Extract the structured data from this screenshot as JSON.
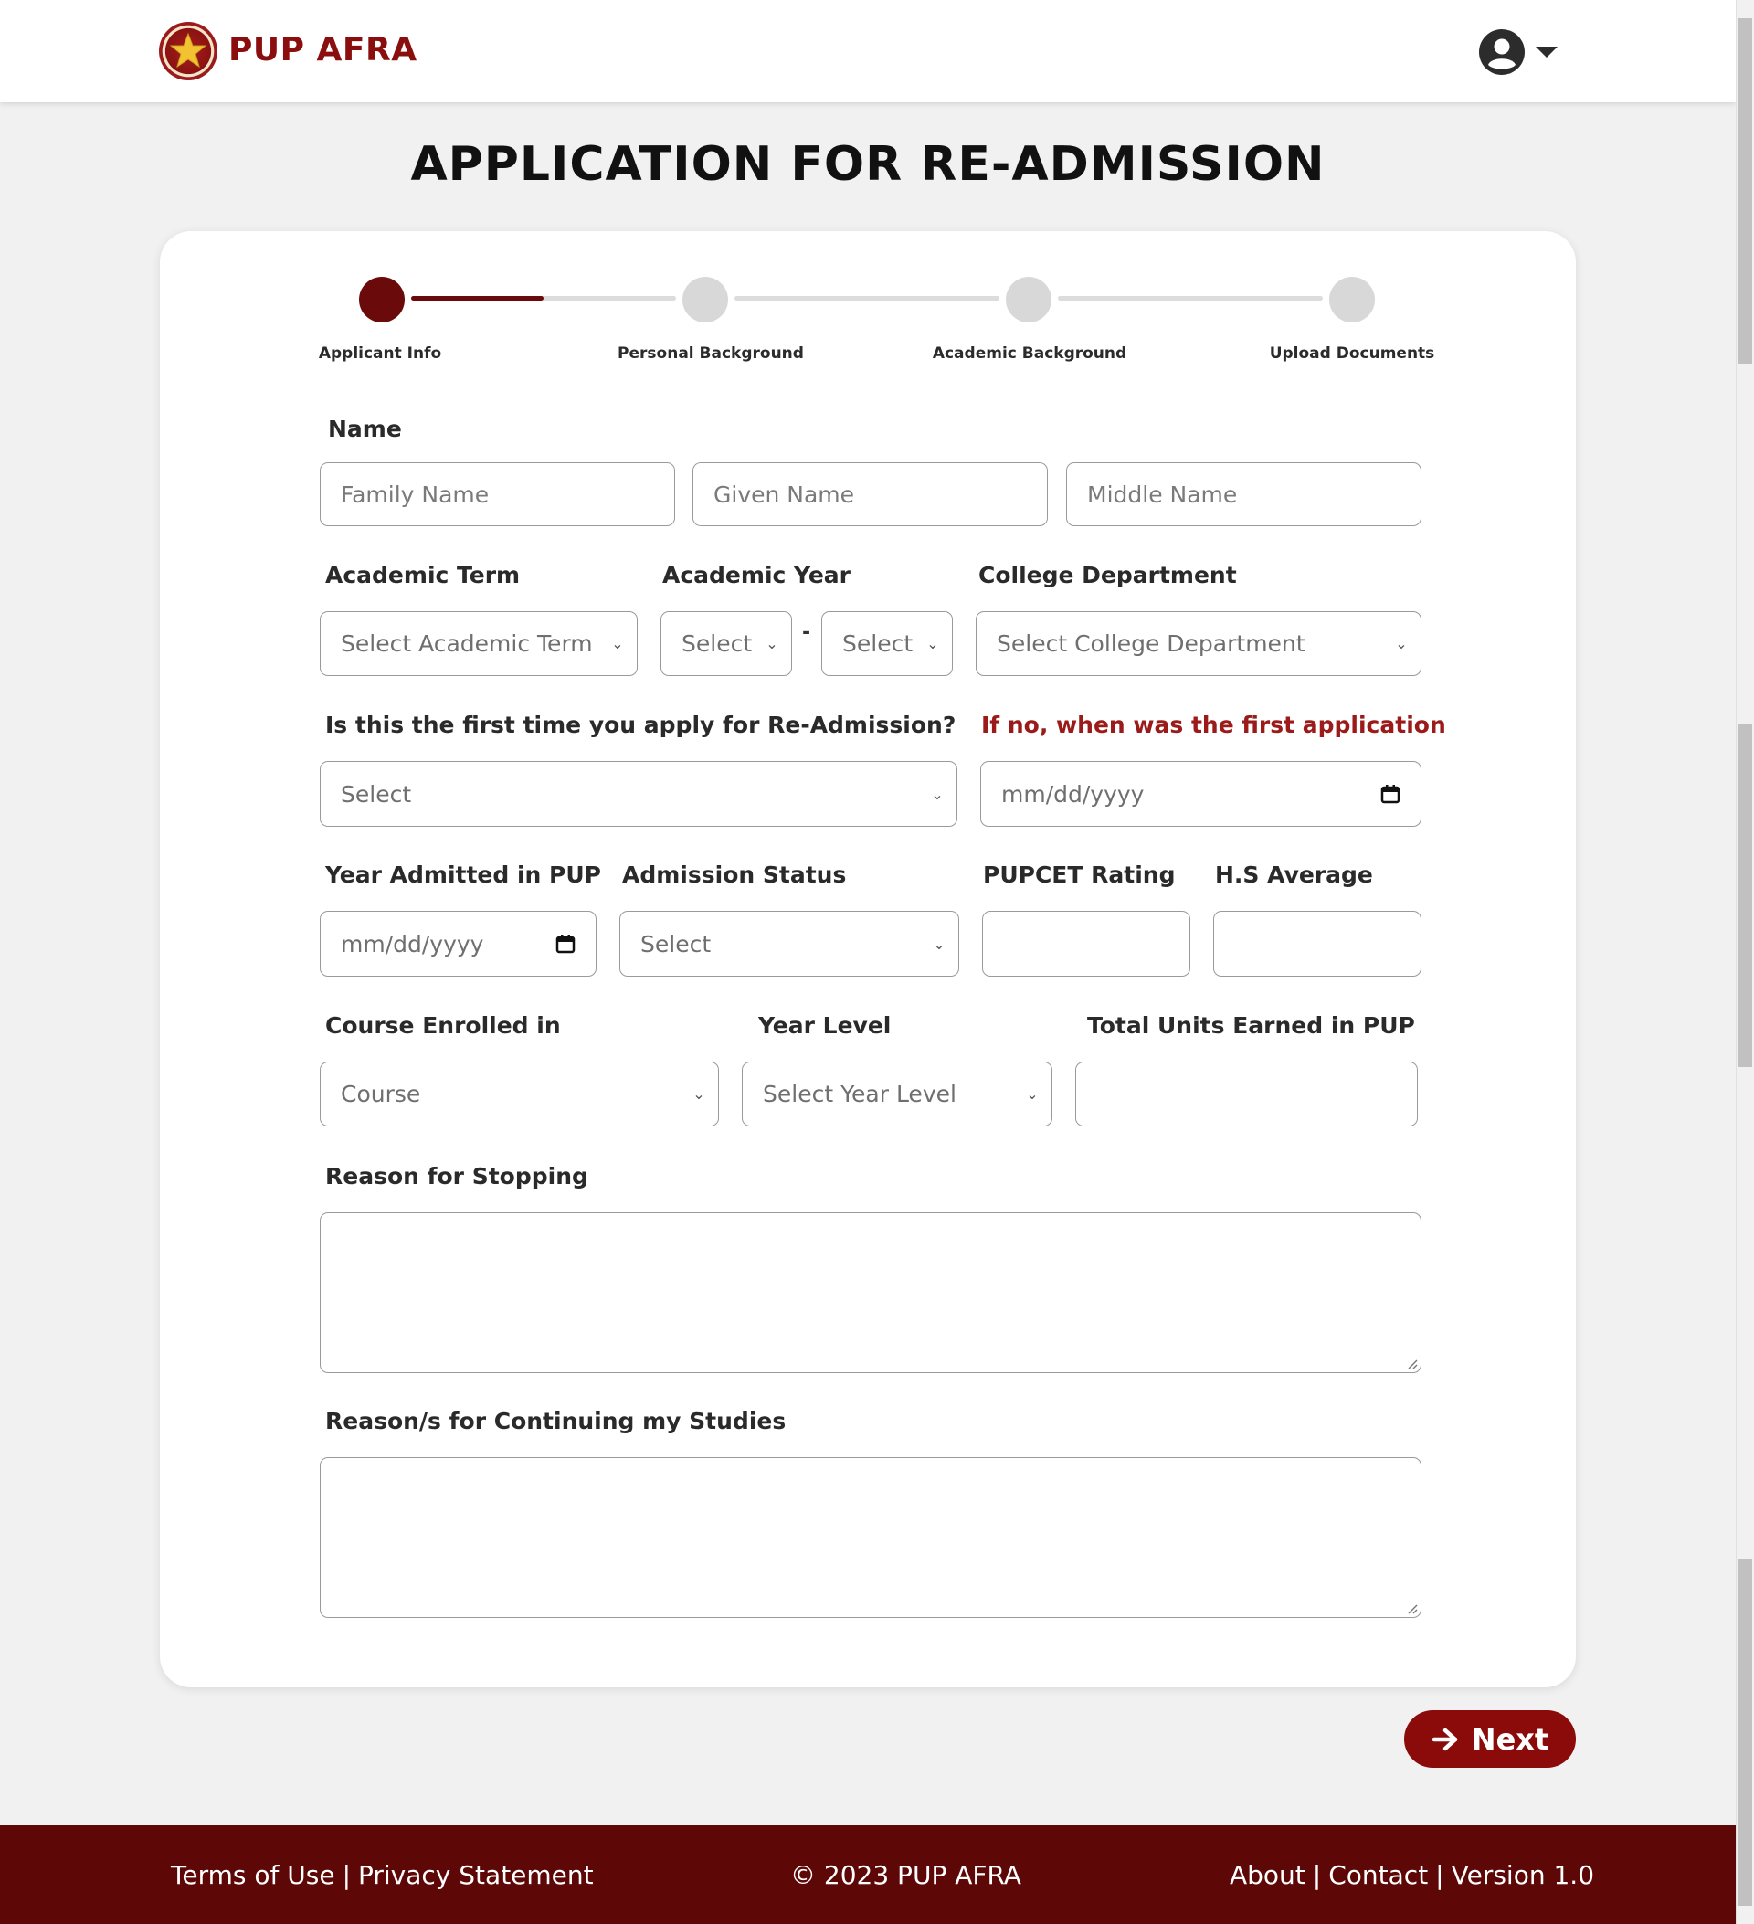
{
  "header": {
    "brand": "PUP AFRA",
    "logo_icon": "pup-seal-icon",
    "user_icon": "user-circle-icon",
    "caret_icon": "caret-down-icon"
  },
  "page": {
    "title": "APPLICATION FOR RE-ADMISSION"
  },
  "stepper": {
    "steps": [
      {
        "label": "Applicant Info",
        "active": true
      },
      {
        "label": "Personal Background",
        "active": false
      },
      {
        "label": "Academic Background",
        "active": false
      },
      {
        "label": "Upload Documents",
        "active": false
      }
    ],
    "progress": 0.5
  },
  "form": {
    "name_label": "Name",
    "family_name_placeholder": "Family Name",
    "given_name_placeholder": "Given Name",
    "middle_name_placeholder": "Middle Name",
    "academic_term_label": "Academic Term",
    "academic_term_value": "Select Academic Term",
    "academic_year_label": "Academic Year",
    "academic_year_start_value": "Select",
    "academic_year_separator": "-",
    "academic_year_end_value": "Select",
    "college_department_label": "College Department",
    "college_department_value": "Select College Department",
    "first_time_label": "Is this the first time you apply for Re-Admission?",
    "first_time_value": "Select",
    "first_application_label": "If no, when was the first application",
    "first_application_placeholder": "mm/dd/yyyy",
    "year_admitted_label": "Year Admitted in PUP",
    "year_admitted_placeholder": "mm/dd/yyyy",
    "admission_status_label": "Admission Status",
    "admission_status_value": "Select",
    "pupcet_label": "PUPCET Rating",
    "hs_average_label": "H.S Average",
    "course_label": "Course Enrolled in",
    "course_value": "Course",
    "year_level_label": "Year Level",
    "year_level_value": "Select Year Level",
    "total_units_label": "Total Units Earned in PUP",
    "reason_stopping_label": "Reason for Stopping",
    "reason_continuing_label": "Reason/s for Continuing my Studies"
  },
  "actions": {
    "next_label": "Next",
    "next_icon": "arrow-right-icon"
  },
  "footer": {
    "terms": "Terms of Use",
    "privacy": "Privacy Statement",
    "separator": "|",
    "copyright": "© 2023 PUP AFRA",
    "about": "About",
    "contact": "Contact",
    "version": "Version 1.0"
  },
  "colors": {
    "brand": "#8b0e0e",
    "accent": "#6a0a0a",
    "footer_bg": "#5e0707",
    "alert_label": "#9b1b1b"
  }
}
